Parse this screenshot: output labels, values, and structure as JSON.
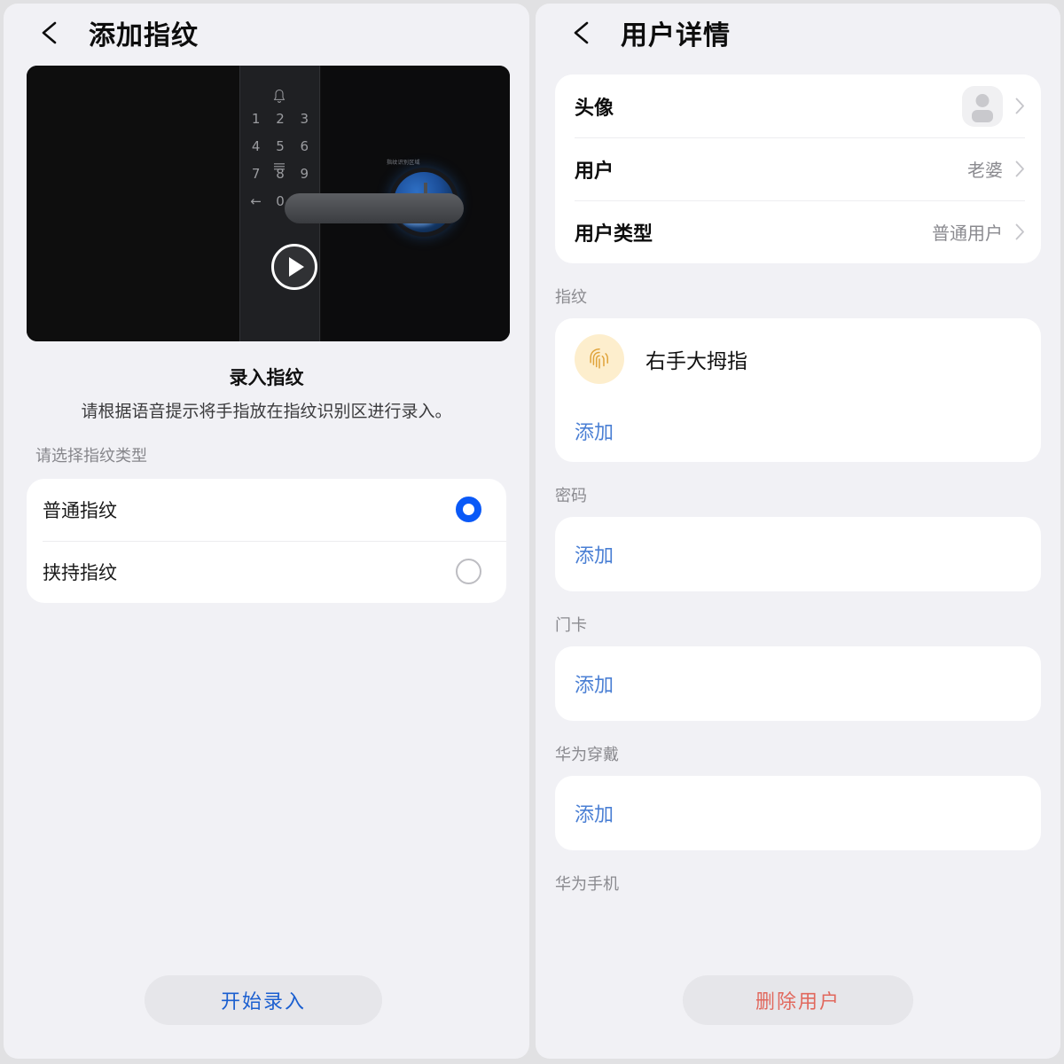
{
  "left_panel": {
    "header": {
      "back_icon": "back-arrow-icon",
      "title": "添加指纹"
    },
    "video": {
      "play_icon": "play-icon",
      "bell_icon": "bell-icon",
      "keypad_keys": [
        "1",
        "2",
        "3",
        "4",
        "5",
        "6",
        "7",
        "8",
        "9",
        "←",
        "0",
        "✓"
      ],
      "sensor_label": "指纹识别区域"
    },
    "enroll_title": "录入指纹",
    "enroll_desc": "请根据语音提示将手指放在指纹识别区进行录入。",
    "type_section_label": "请选择指纹类型",
    "fingerprint_types": [
      {
        "label": "普通指纹",
        "selected": true
      },
      {
        "label": "挟持指纹",
        "selected": false
      }
    ],
    "start_button": "开始录入"
  },
  "right_panel": {
    "header": {
      "back_icon": "back-arrow-icon",
      "title": "用户详情"
    },
    "info_rows": [
      {
        "key": "头像",
        "value": "",
        "has_avatar": true
      },
      {
        "key": "用户",
        "value": "老婆",
        "has_avatar": false
      },
      {
        "key": "用户类型",
        "value": "普通用户",
        "has_avatar": false
      }
    ],
    "groups": [
      {
        "label": "指纹",
        "item": "右手大拇指",
        "add": "添加"
      },
      {
        "label": "密码",
        "item": "",
        "add": "添加"
      },
      {
        "label": "门卡",
        "item": "",
        "add": "添加"
      },
      {
        "label": "华为穿戴",
        "item": "",
        "add": "添加"
      },
      {
        "label": "华为手机",
        "item": "",
        "add": ""
      }
    ],
    "delete_button": "删除用户"
  },
  "colors": {
    "page_bg": "#e1e1e3",
    "panel_bg": "#f1f1f5",
    "card_bg": "#ffffff",
    "accent_blue": "#0a59f7",
    "link_blue": "#4a7fd4",
    "danger_red": "#e1685d",
    "fingerprint_gold": "#e0a33a"
  }
}
